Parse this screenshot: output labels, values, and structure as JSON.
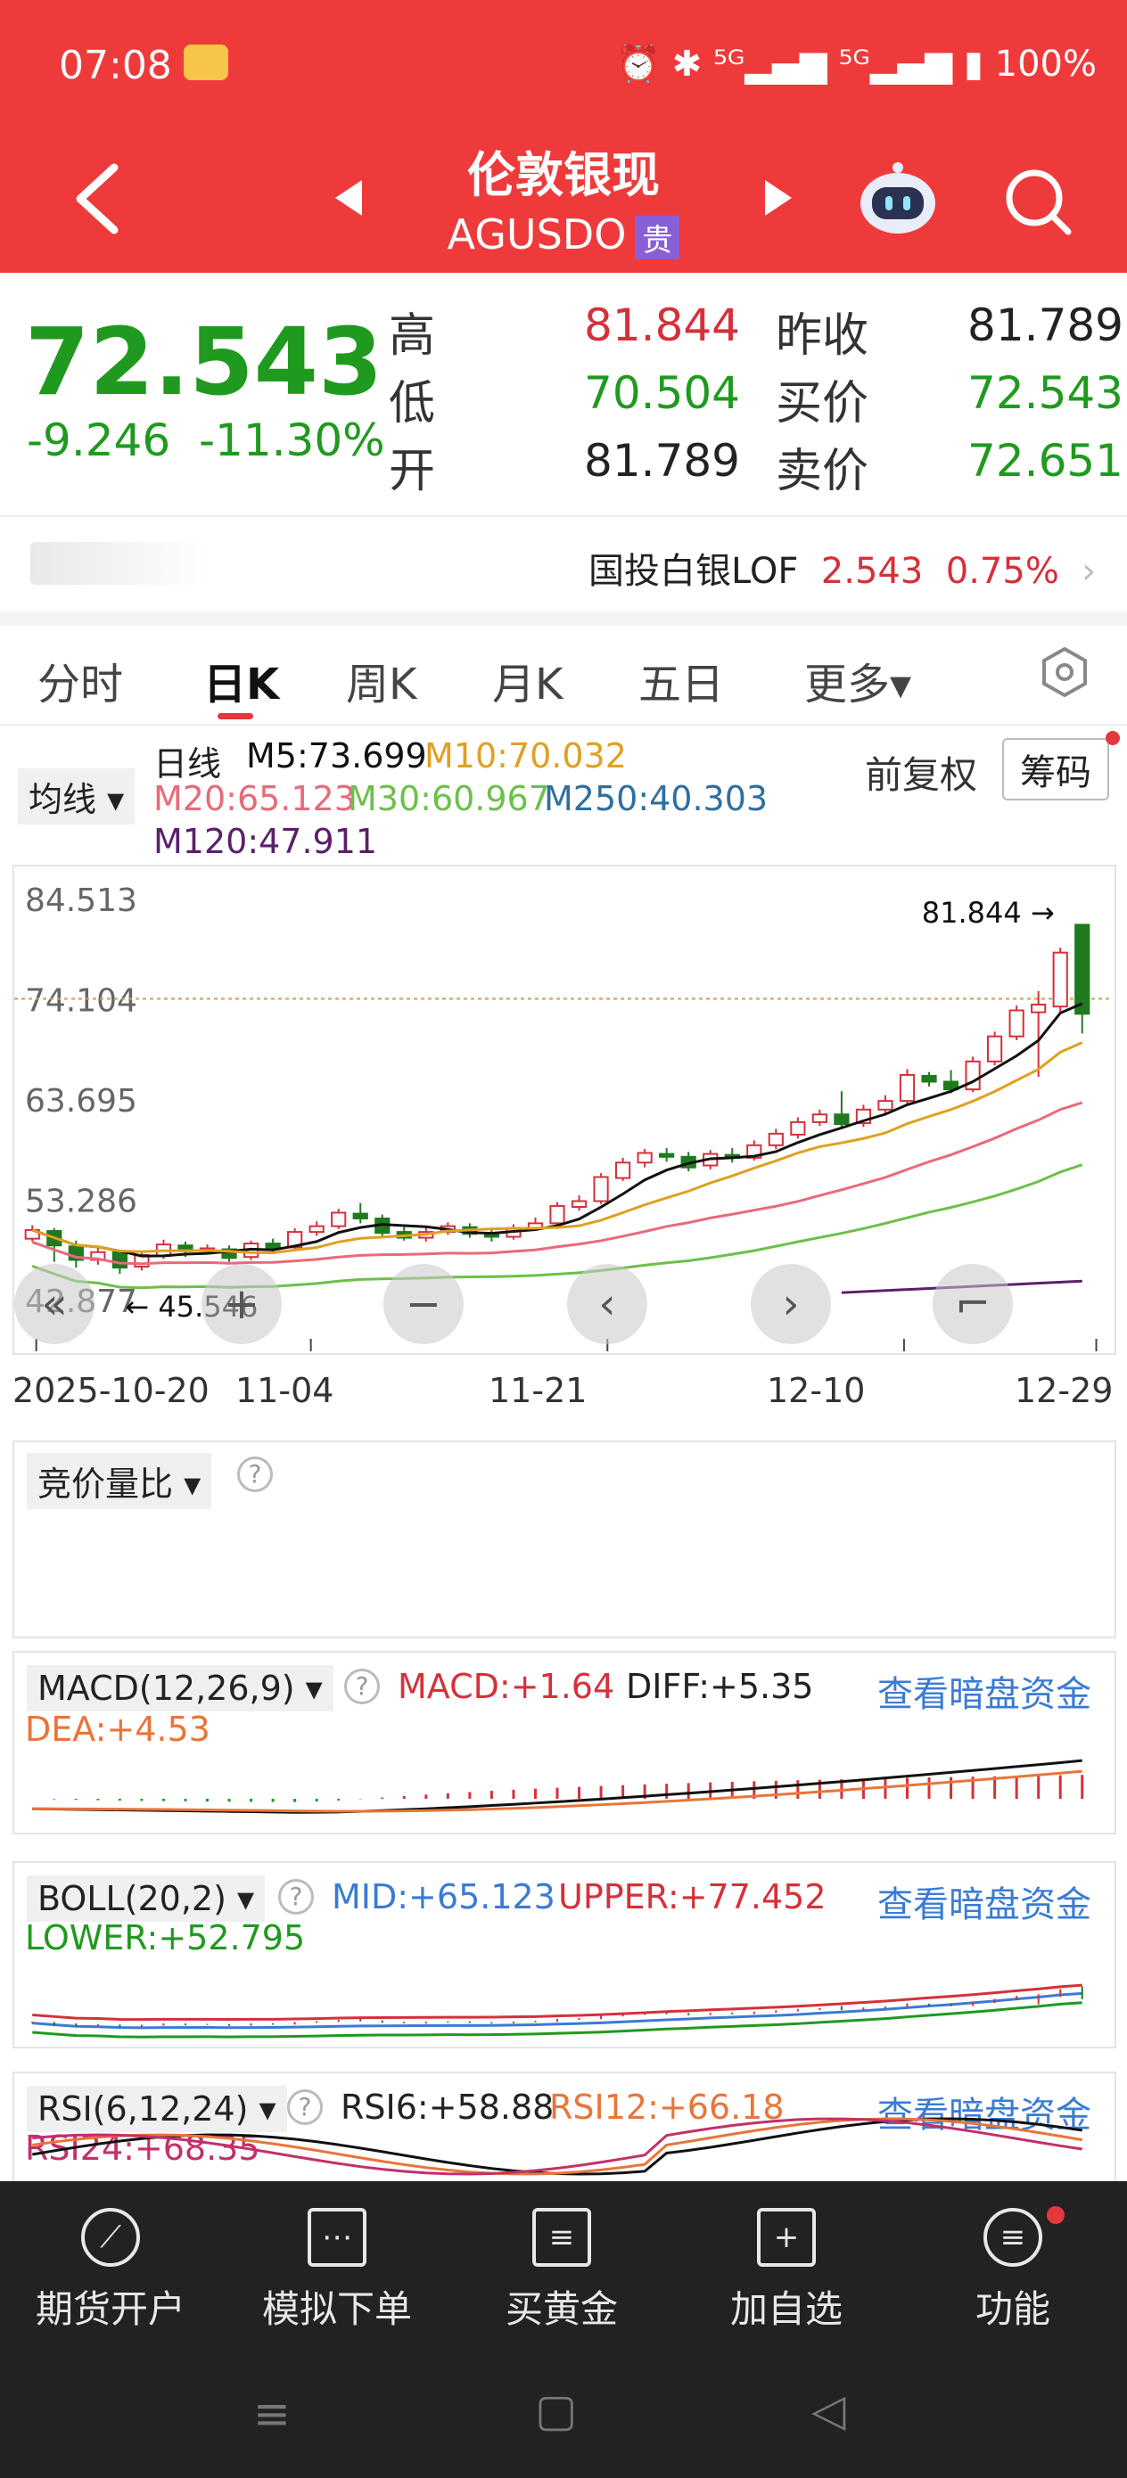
{
  "status_bar": {
    "time": "07:08",
    "right": "⏰ ✱ ⁵ᴳ▂▄▆ ⁵ᴳ▂▄▆ ▮ 100%"
  },
  "header": {
    "title": "伦敦银现",
    "code": "AGUSDO",
    "tag": "贵"
  },
  "quote": {
    "price": "72.543",
    "change": "-9.246",
    "change_pct": "-11.30%",
    "rows": [
      {
        "label1": "高",
        "value1": "81.844",
        "label2": "昨收",
        "value2": "81.789"
      },
      {
        "label1": "低",
        "value1": "70.504",
        "label2": "买价",
        "value2": "72.543"
      },
      {
        "label1": "开",
        "value1": "81.789",
        "label2": "卖价",
        "value2": "72.651"
      }
    ]
  },
  "related": {
    "name": "国投白银LOF",
    "price": "2.543",
    "pct": "0.75%"
  },
  "tabs": [
    "分时",
    "日K",
    "周K",
    "月K",
    "五日",
    "更多▾"
  ],
  "ma_panel": {
    "dropdown": "均线 ▾",
    "period": "日线",
    "m5": "M5:73.699",
    "m10": "M10:70.032",
    "m20": "M20:65.123",
    "m30": "M30:60.967",
    "m250": "M250:40.303",
    "m120": "M120:47.911",
    "adjust": "前复权",
    "chips": "筹码"
  },
  "colors": {
    "up": "#d6303a",
    "down": "#1f7a1f",
    "m5": "#111111",
    "m10": "#e0a020",
    "m20": "#e86a7a",
    "m30": "#6cc04a",
    "m120": "#5b1f6a"
  },
  "chart_data": {
    "type": "candlestick",
    "y_ticks": [
      "84.513",
      "74.104",
      "63.695",
      "53.286",
      "42.877"
    ],
    "ylim": [
      42.877,
      84.513
    ],
    "x_ticks": [
      "2025-10-20",
      "11-04",
      "11-21",
      "12-10",
      "12-29"
    ],
    "high_label": "81.844",
    "low_label": "45.546",
    "candles": [
      {
        "o": 49.2,
        "c": 50.1,
        "h": 50.6,
        "l": 48.9
      },
      {
        "o": 50.0,
        "c": 48.5,
        "h": 50.3,
        "l": 46.8
      },
      {
        "o": 48.4,
        "c": 47.0,
        "h": 49.0,
        "l": 46.2
      },
      {
        "o": 47.0,
        "c": 47.8,
        "h": 48.3,
        "l": 46.5
      },
      {
        "o": 47.8,
        "c": 46.2,
        "h": 48.0,
        "l": 45.546
      },
      {
        "o": 46.3,
        "c": 47.5,
        "h": 47.9,
        "l": 45.9
      },
      {
        "o": 47.4,
        "c": 48.6,
        "h": 49.1,
        "l": 47.1
      },
      {
        "o": 48.5,
        "c": 47.9,
        "h": 48.9,
        "l": 47.3
      },
      {
        "o": 48.0,
        "c": 48.2,
        "h": 48.6,
        "l": 47.6
      },
      {
        "o": 48.1,
        "c": 47.2,
        "h": 48.5,
        "l": 46.8
      },
      {
        "o": 47.3,
        "c": 48.7,
        "h": 49.0,
        "l": 47.0
      },
      {
        "o": 48.7,
        "c": 48.2,
        "h": 49.2,
        "l": 47.8
      },
      {
        "o": 48.3,
        "c": 49.9,
        "h": 50.3,
        "l": 48.0
      },
      {
        "o": 49.9,
        "c": 50.5,
        "h": 51.0,
        "l": 49.5
      },
      {
        "o": 50.5,
        "c": 51.9,
        "h": 52.3,
        "l": 50.2
      },
      {
        "o": 51.8,
        "c": 51.3,
        "h": 52.9,
        "l": 50.8
      },
      {
        "o": 51.3,
        "c": 49.8,
        "h": 51.7,
        "l": 49.4
      },
      {
        "o": 49.9,
        "c": 49.3,
        "h": 50.4,
        "l": 49.0
      },
      {
        "o": 49.3,
        "c": 49.9,
        "h": 50.5,
        "l": 48.9
      },
      {
        "o": 49.9,
        "c": 50.5,
        "h": 50.9,
        "l": 49.6
      },
      {
        "o": 50.4,
        "c": 49.7,
        "h": 50.8,
        "l": 49.3
      },
      {
        "o": 49.7,
        "c": 49.4,
        "h": 50.2,
        "l": 48.9
      },
      {
        "o": 49.4,
        "c": 50.3,
        "h": 50.7,
        "l": 49.1
      },
      {
        "o": 50.3,
        "c": 50.8,
        "h": 51.4,
        "l": 50.0
      },
      {
        "o": 50.8,
        "c": 52.6,
        "h": 53.0,
        "l": 50.4
      },
      {
        "o": 52.5,
        "c": 53.1,
        "h": 53.7,
        "l": 52.1
      },
      {
        "o": 53.1,
        "c": 55.6,
        "h": 56.0,
        "l": 52.8
      },
      {
        "o": 55.5,
        "c": 57.1,
        "h": 57.6,
        "l": 55.2
      },
      {
        "o": 57.1,
        "c": 58.1,
        "h": 58.5,
        "l": 56.6
      },
      {
        "o": 58.0,
        "c": 57.7,
        "h": 58.6,
        "l": 57.2
      },
      {
        "o": 57.7,
        "c": 56.6,
        "h": 58.2,
        "l": 56.2
      },
      {
        "o": 56.8,
        "c": 58.0,
        "h": 58.4,
        "l": 56.4
      },
      {
        "o": 57.9,
        "c": 57.6,
        "h": 58.6,
        "l": 57.1
      },
      {
        "o": 57.6,
        "c": 58.9,
        "h": 59.4,
        "l": 57.3
      },
      {
        "o": 58.9,
        "c": 60.1,
        "h": 60.6,
        "l": 58.5
      },
      {
        "o": 60.0,
        "c": 61.3,
        "h": 61.8,
        "l": 59.6
      },
      {
        "o": 61.3,
        "c": 62.1,
        "h": 62.6,
        "l": 60.9
      },
      {
        "o": 62.1,
        "c": 61.1,
        "h": 64.5,
        "l": 60.8
      },
      {
        "o": 61.2,
        "c": 62.6,
        "h": 63.1,
        "l": 60.8
      },
      {
        "o": 62.6,
        "c": 63.5,
        "h": 64.1,
        "l": 62.2
      },
      {
        "o": 63.5,
        "c": 66.2,
        "h": 66.8,
        "l": 63.1
      },
      {
        "o": 66.1,
        "c": 65.5,
        "h": 66.5,
        "l": 65.0
      },
      {
        "o": 65.5,
        "c": 64.7,
        "h": 66.7,
        "l": 64.3
      },
      {
        "o": 64.7,
        "c": 67.6,
        "h": 68.1,
        "l": 64.4
      },
      {
        "o": 67.6,
        "c": 70.2,
        "h": 70.7,
        "l": 67.2
      },
      {
        "o": 70.2,
        "c": 72.9,
        "h": 73.4,
        "l": 69.8
      },
      {
        "o": 72.7,
        "c": 73.5,
        "h": 74.9,
        "l": 66.0
      },
      {
        "o": 73.3,
        "c": 78.9,
        "h": 79.4,
        "l": 72.6
      },
      {
        "o": 81.789,
        "c": 72.543,
        "h": 81.844,
        "l": 70.504
      }
    ]
  },
  "controls": [
    "«",
    "+",
    "−",
    "‹",
    "›",
    "⌐"
  ],
  "auction": {
    "label": "竞价量比 ▾"
  },
  "macd": {
    "label": "MACD(12,26,9) ▾",
    "macd": "MACD:+1.64",
    "diff": "DIFF:+5.35",
    "dea": "DEA:+4.53",
    "link": "查看暗盘资金"
  },
  "boll": {
    "label": "BOLL(20,2) ▾",
    "mid": "MID:+65.123",
    "upper": "UPPER:+77.452",
    "lower": "LOWER:+52.795",
    "link": "查看暗盘资金"
  },
  "rsi": {
    "label": "RSI(6,12,24) ▾",
    "rsi6": "RSI6:+58.88",
    "rsi12": "RSI12:+66.18",
    "rsi24": "RSI24:+68.35",
    "link": "查看暗盘资金"
  },
  "bottom_nav": [
    {
      "label": "期货开户",
      "icon": "⟋"
    },
    {
      "label": "模拟下单",
      "icon": "⋯"
    },
    {
      "label": "买黄金",
      "icon": "≡"
    },
    {
      "label": "加自选",
      "icon": "+"
    },
    {
      "label": "功能",
      "icon": "≡"
    }
  ],
  "sys_nav": {
    "menu": "≡",
    "home": "▢",
    "back": "◁"
  }
}
